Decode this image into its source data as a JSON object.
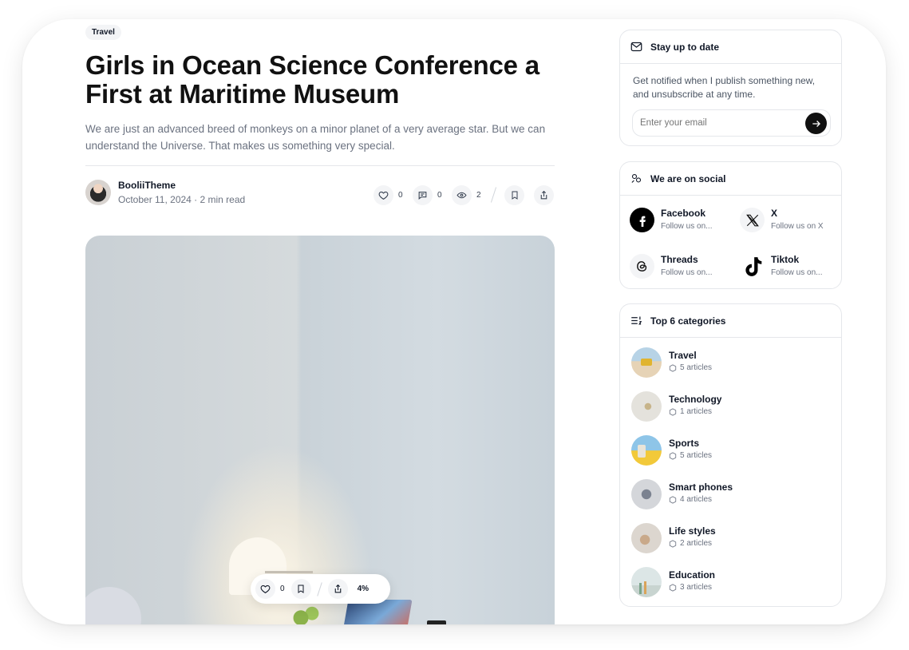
{
  "article": {
    "tag": "Travel",
    "title": "Girls in Ocean Science Conference a First at Maritime Museum",
    "subtitle": "We are just an advanced breed of monkeys on a minor planet of a very average star. But we can understand the Universe. That makes us something very special.",
    "author": "BooliiTheme",
    "date_readtime": "October 11, 2024 · 2 min read",
    "likes": "0",
    "comments": "0",
    "views": "2"
  },
  "floatbar": {
    "likes": "0",
    "progress": "4%"
  },
  "newsletter": {
    "title": "Stay up to date",
    "text": "Get notified when I publish something new, and unsubscribe at any time.",
    "placeholder": "Enter your email"
  },
  "social": {
    "title": "We are on social",
    "items": [
      {
        "name": "Facebook",
        "sub": "Follow us on...",
        "icon": "facebook-icon"
      },
      {
        "name": "X",
        "sub": "Follow us on X",
        "icon": "x-icon"
      },
      {
        "name": "Threads",
        "sub": "Follow us on...",
        "icon": "threads-icon"
      },
      {
        "name": "Tiktok",
        "sub": "Follow us on...",
        "icon": "tiktok-icon"
      }
    ]
  },
  "categories": {
    "title": "Top 6 categories",
    "items": [
      {
        "name": "Travel",
        "count": "5 articles"
      },
      {
        "name": "Technology",
        "count": "1 articles"
      },
      {
        "name": "Sports",
        "count": "5 articles"
      },
      {
        "name": "Smart phones",
        "count": "4 articles"
      },
      {
        "name": "Life styles",
        "count": "2 articles"
      },
      {
        "name": "Education",
        "count": "3 articles"
      }
    ]
  }
}
